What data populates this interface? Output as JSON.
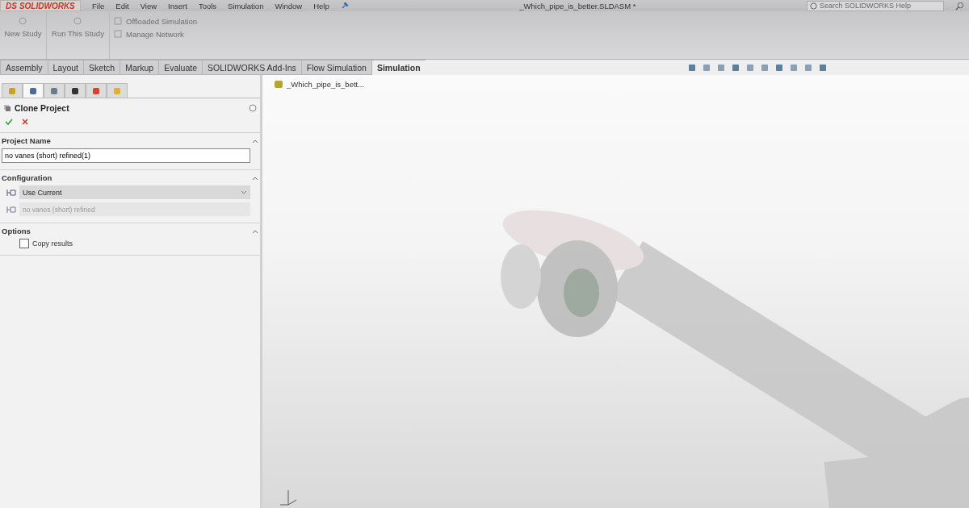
{
  "logo": {
    "mark": "DS",
    "name": "SOLIDWORKS"
  },
  "menu": [
    "File",
    "Edit",
    "View",
    "Insert",
    "Tools",
    "Simulation",
    "Window",
    "Help"
  ],
  "document_title": "_Which_pipe_is_better.SLDASM *",
  "search": {
    "placeholder": "Search SOLIDWORKS Help"
  },
  "ribbon": {
    "large_buttons": [
      {
        "label": "New Study",
        "disabled": true
      },
      {
        "label": "Run This Study",
        "disabled": true
      }
    ],
    "small_buttons": [
      {
        "label": "Offloaded Simulation",
        "disabled": true
      },
      {
        "label": "Manage Network",
        "disabled": true
      }
    ]
  },
  "tabs": [
    {
      "label": "Assembly",
      "selected": false
    },
    {
      "label": "Layout",
      "selected": false
    },
    {
      "label": "Sketch",
      "selected": false
    },
    {
      "label": "Markup",
      "selected": false
    },
    {
      "label": "Evaluate",
      "selected": false
    },
    {
      "label": "SOLIDWORKS Add-Ins",
      "selected": false
    },
    {
      "label": "Flow Simulation",
      "selected": false
    },
    {
      "label": "Simulation",
      "selected": true
    }
  ],
  "panel_tabs": [
    {
      "selected": false
    },
    {
      "selected": true
    },
    {
      "selected": false
    },
    {
      "selected": false
    },
    {
      "selected": false
    },
    {
      "selected": false
    }
  ],
  "property_manager": {
    "title": "Clone Project",
    "sections": [
      {
        "kind": "text",
        "title": "Project Name",
        "expanded": true,
        "value": "no vanes (short) refined(1)"
      },
      {
        "kind": "config",
        "title": "Configuration",
        "expanded": true,
        "value": "Use Current",
        "disabled_value": "no vanes (short) refined"
      },
      {
        "kind": "options",
        "title": "Options",
        "expanded": true,
        "options": [
          {
            "label": "Copy results",
            "checked": false
          }
        ]
      }
    ]
  },
  "tree": {
    "item": "_Which_pipe_is_bett..."
  }
}
